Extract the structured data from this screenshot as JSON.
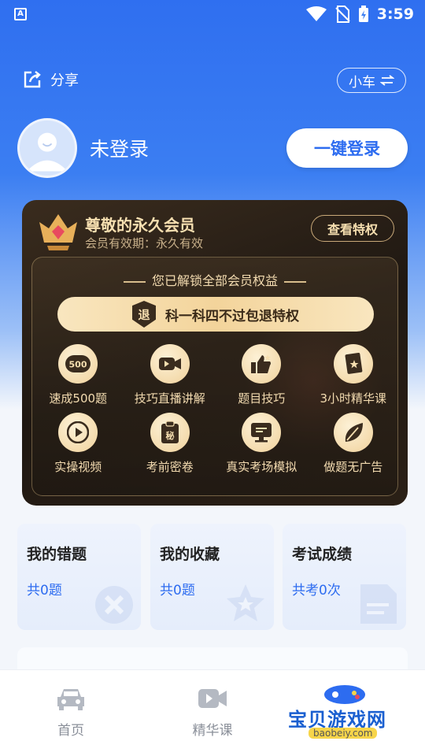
{
  "status_bar": {
    "time": "3:59",
    "left_icon_text": "A"
  },
  "header": {
    "share_label": "分享",
    "car_switch_label": "小车"
  },
  "profile": {
    "username": "未登录",
    "login_button": "一键登录"
  },
  "vip": {
    "title": "尊敬的永久会员",
    "expiry": "会员有效期：永久有效",
    "privilege_button": "查看特权",
    "unlocked_text": "您已解锁全部会员权益",
    "refund_badge": "退",
    "refund_text": "科一科四不过包退特权",
    "benefits": [
      {
        "label": "速成500题",
        "icon": "500-badge-icon"
      },
      {
        "label": "技巧直播讲解",
        "icon": "video-camera-icon"
      },
      {
        "label": "题目技巧",
        "icon": "thumbs-up-icon"
      },
      {
        "label": "3小时精华课",
        "icon": "star-book-icon"
      },
      {
        "label": "实操视频",
        "icon": "play-icon"
      },
      {
        "label": "考前密卷",
        "icon": "secret-clipboard-icon"
      },
      {
        "label": "真实考场模拟",
        "icon": "monitor-icon"
      },
      {
        "label": "做题无广告",
        "icon": "leaf-icon"
      }
    ],
    "benefit_500_text": "500",
    "benefit_secret_text": "秘"
  },
  "stats": [
    {
      "title": "我的错题",
      "value": "共0题"
    },
    {
      "title": "我的收藏",
      "value": "共0题"
    },
    {
      "title": "考试成绩",
      "value": "共考0次"
    }
  ],
  "nav": [
    {
      "label": "首页",
      "icon": "car-icon"
    },
    {
      "label": "精华课",
      "icon": "video-icon"
    }
  ],
  "watermark": {
    "text": "宝贝游戏网",
    "sub": "baobeiy.com"
  },
  "colors": {
    "primary": "#2d6cf0",
    "gold": "#f3dbb0",
    "vip_bg": "#1f1812"
  }
}
